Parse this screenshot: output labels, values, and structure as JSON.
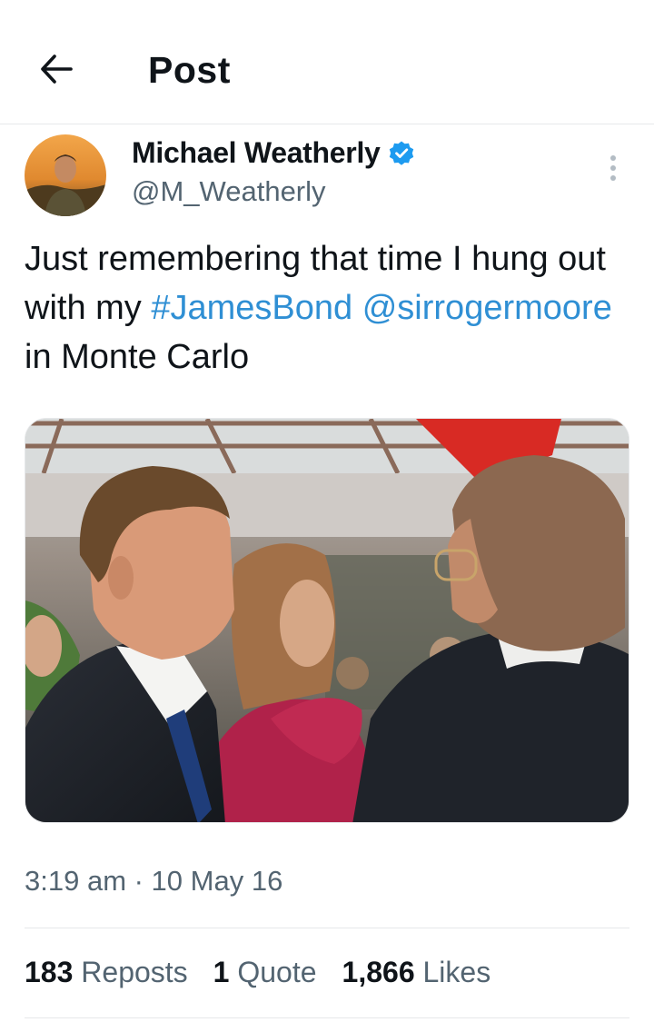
{
  "header": {
    "title": "Post",
    "back_icon": "arrow-left-icon"
  },
  "author": {
    "name": "Michael Weatherly",
    "handle": "@M_Weatherly",
    "verified": true,
    "verified_color": "#1d9bf0"
  },
  "tweet": {
    "text_part1": "Just remembering that time I hung out with my ",
    "hashtag": "#JamesBond",
    "space": " ",
    "mention": "@sirrogermoore",
    "text_part2": " in Monte Carlo",
    "link_color": "#2f8fd4"
  },
  "meta": {
    "timestamp": "3:19 am · 10 May 16"
  },
  "stats": {
    "reposts_count": "183",
    "reposts_label": "Reposts",
    "quotes_count": "1",
    "quotes_label": "Quote",
    "likes_count": "1,866",
    "likes_label": "Likes"
  }
}
